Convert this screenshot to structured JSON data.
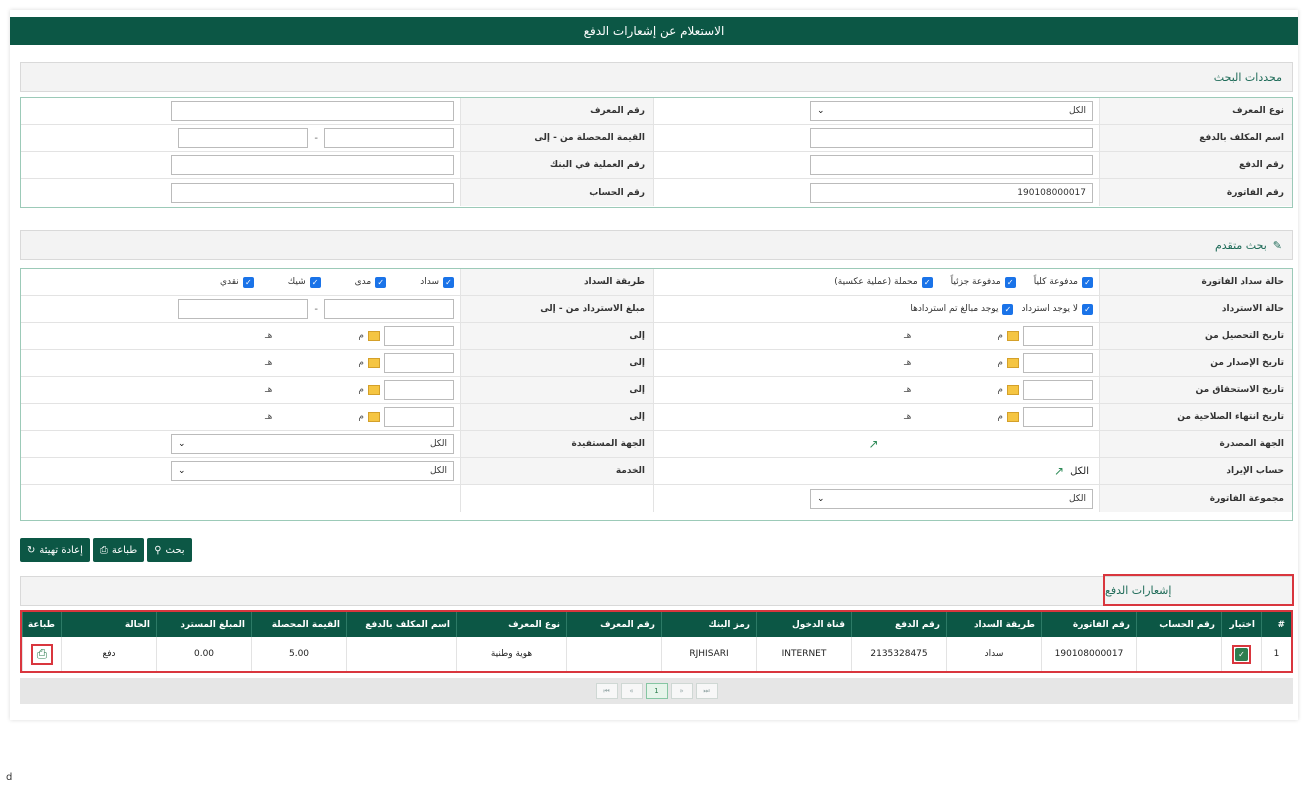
{
  "page_title": "الاستعلام عن إشعارات الدفع",
  "search_section": {
    "title": "محددات البحث",
    "rows": [
      {
        "label": "نوع المعرف",
        "value": "الكل",
        "label2": "رقم المعرف",
        "value2": ""
      },
      {
        "label": "اسم المكلف بالدفع",
        "value": "",
        "label2": "القيمة المحصلة من - إلى",
        "value2": ""
      },
      {
        "label": "رقم الدفع",
        "value": "",
        "label2": "رقم العملية في البنك",
        "value2": ""
      },
      {
        "label": "رقم الفاتورة",
        "value": "190108000017",
        "label2": "رقم الحساب",
        "value2": ""
      }
    ]
  },
  "advanced_section": {
    "title": "بحث متقدم",
    "invoice_status_label": "حالة سداد الفاتورة",
    "invoice_status_options": [
      "مدفوعة كلياً",
      "مدفوعة جزئياً",
      "محملة (عملية عكسية)"
    ],
    "payment_method_label": "طريقة السداد",
    "payment_method_options": [
      "سداد",
      "مدى",
      "شيك",
      "نقدي"
    ],
    "refund_status_label": "حالة الاسترداد",
    "refund_status_options": [
      "لا يوجد استرداد",
      "يوجد مبالغ تم استردادها"
    ],
    "refund_amount_label": "مبلغ الاسترداد من - إلى",
    "to_label": "إلى",
    "gregorian": "م",
    "hijri": "هـ",
    "date_rows": [
      "تاريخ التحصيل من",
      "تاريخ الإصدار من",
      "تاريخ الاستحقاق من",
      "تاريخ انتهاء الصلاحية من"
    ],
    "issuer_label": "الجهة المصدرة",
    "beneficiary_label": "الجهة المستفيدة",
    "beneficiary_value": "الكل",
    "revenue_account_label": "حساب الإيراد",
    "revenue_account_value": "الكل",
    "service_label": "الخدمة",
    "service_value": "الكل",
    "invoice_group_label": "مجموعة الفاتورة",
    "invoice_group_value": "الكل"
  },
  "buttons": {
    "search": "بحث",
    "print": "طباعة",
    "reset": "إعادة تهيئة"
  },
  "results": {
    "title": "إشعارات الدفع",
    "columns": [
      "#",
      "اختيار",
      "رقم الحساب",
      "رقم الفاتورة",
      "طريقة السداد",
      "رقم الدفع",
      "قناة الدخول",
      "رمز البنك",
      "رقم المعرف",
      "نوع المعرف",
      "اسم المكلف بالدفع",
      "القيمة المحصلة",
      "المبلغ المسترد",
      "الحالة",
      "طباعة"
    ],
    "rows": [
      {
        "num": "1",
        "account": "",
        "invoice": "190108000017",
        "method": "سداد",
        "payment_no": "2135328475",
        "channel": "INTERNET",
        "bank_code": "RJHISARI",
        "id_no": "",
        "id_type": "هوية وطنية",
        "payer": "",
        "collected": "5.00",
        "refunded": "0.00",
        "status": "دفع"
      }
    ],
    "pager": [
      "⏮",
      "«",
      "1",
      "»",
      "⏭"
    ]
  },
  "footer_char": "d",
  "colors": {
    "primary": "#0c5745",
    "highlight": "#d9363e",
    "checkbox": "#1a73e8"
  }
}
